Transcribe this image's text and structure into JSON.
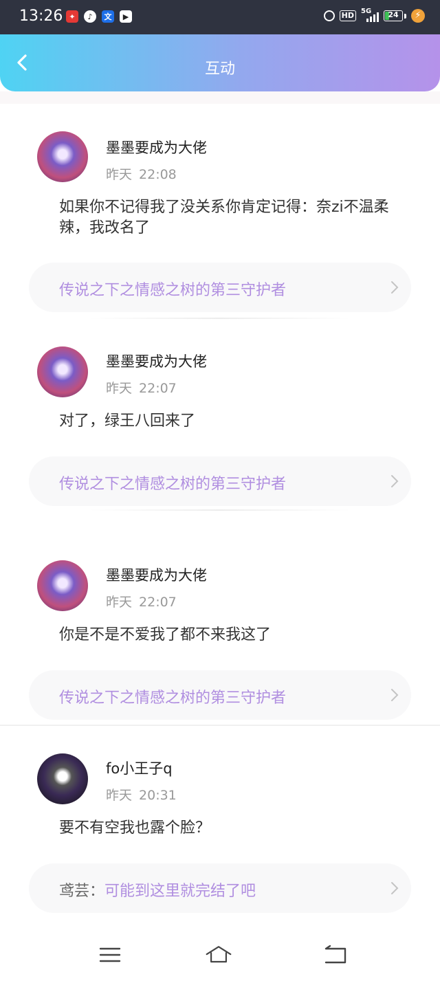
{
  "status_bar": {
    "time": "13:26",
    "network": "5G",
    "battery": "24",
    "hd": "HD"
  },
  "header": {
    "title": "互动"
  },
  "items": [
    {
      "username": "墨墨要成为大佬",
      "date": "昨天",
      "time": "22:08",
      "message": "如果你不记得我了没关系你肯定记得：奈zi不温柔辣，我改名了",
      "link": "传说之下之情感之树的第三守护者"
    },
    {
      "username": "墨墨要成为大佬",
      "date": "昨天",
      "time": "22:07",
      "message": "对了，绿王八回来了",
      "link": "传说之下之情感之树的第三守护者"
    },
    {
      "username": "墨墨要成为大佬",
      "date": "昨天",
      "time": "22:07",
      "message": "你是不是不爱我了都不来我这了",
      "link": "传说之下之情感之树的第三守护者"
    },
    {
      "username": "fo小王子q",
      "date": "昨天",
      "time": "20:31",
      "message": "要不有空我也露个脸？",
      "link_prefix": "鸢芸：",
      "link": "可能到这里就完结了吧"
    }
  ],
  "colors": {
    "header_start": "#4fd3f3",
    "header_end": "#b592ea",
    "link": "#b08ee0"
  }
}
